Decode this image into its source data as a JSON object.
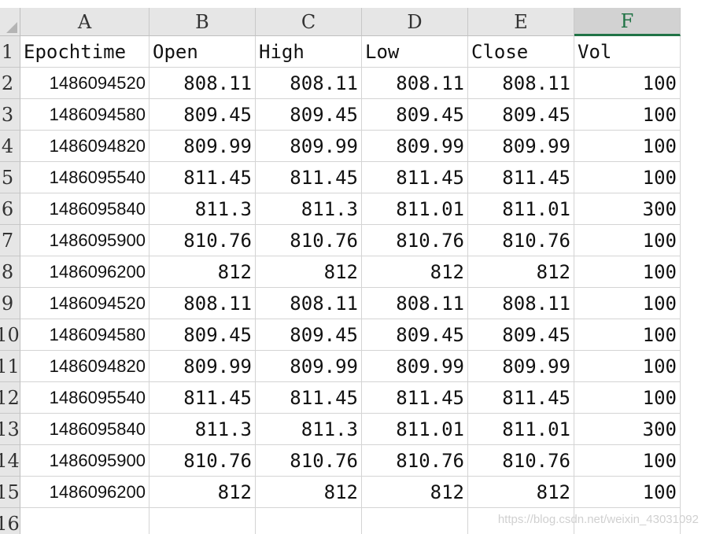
{
  "columns": [
    "A",
    "B",
    "C",
    "D",
    "E",
    "F"
  ],
  "selected_column": "F",
  "row_numbers": [
    "1",
    "2",
    "3",
    "4",
    "5",
    "6",
    "7",
    "8",
    "9",
    "10",
    "11",
    "12",
    "13",
    "14",
    "15",
    "16"
  ],
  "header_row": [
    "Epochtime",
    "Open",
    "High",
    "Low",
    "Close",
    "Vol"
  ],
  "rows": [
    [
      "1486094520",
      "808.11",
      "808.11",
      "808.11",
      "808.11",
      "100"
    ],
    [
      "1486094580",
      "809.45",
      "809.45",
      "809.45",
      "809.45",
      "100"
    ],
    [
      "1486094820",
      "809.99",
      "809.99",
      "809.99",
      "809.99",
      "100"
    ],
    [
      "1486095540",
      "811.45",
      "811.45",
      "811.45",
      "811.45",
      "100"
    ],
    [
      "1486095840",
      "811.3",
      "811.3",
      "811.01",
      "811.01",
      "300"
    ],
    [
      "1486095900",
      "810.76",
      "810.76",
      "810.76",
      "810.76",
      "100"
    ],
    [
      "1486096200",
      "812",
      "812",
      "812",
      "812",
      "100"
    ],
    [
      "1486094520",
      "808.11",
      "808.11",
      "808.11",
      "808.11",
      "100"
    ],
    [
      "1486094580",
      "809.45",
      "809.45",
      "809.45",
      "809.45",
      "100"
    ],
    [
      "1486094820",
      "809.99",
      "809.99",
      "809.99",
      "809.99",
      "100"
    ],
    [
      "1486095540",
      "811.45",
      "811.45",
      "811.45",
      "811.45",
      "100"
    ],
    [
      "1486095840",
      "811.3",
      "811.3",
      "811.01",
      "811.01",
      "300"
    ],
    [
      "1486095900",
      "810.76",
      "810.76",
      "810.76",
      "810.76",
      "100"
    ],
    [
      "1486096200",
      "812",
      "812",
      "812",
      "812",
      "100"
    ]
  ],
  "watermark": "https://blog.csdn.net/weixin_43031092"
}
